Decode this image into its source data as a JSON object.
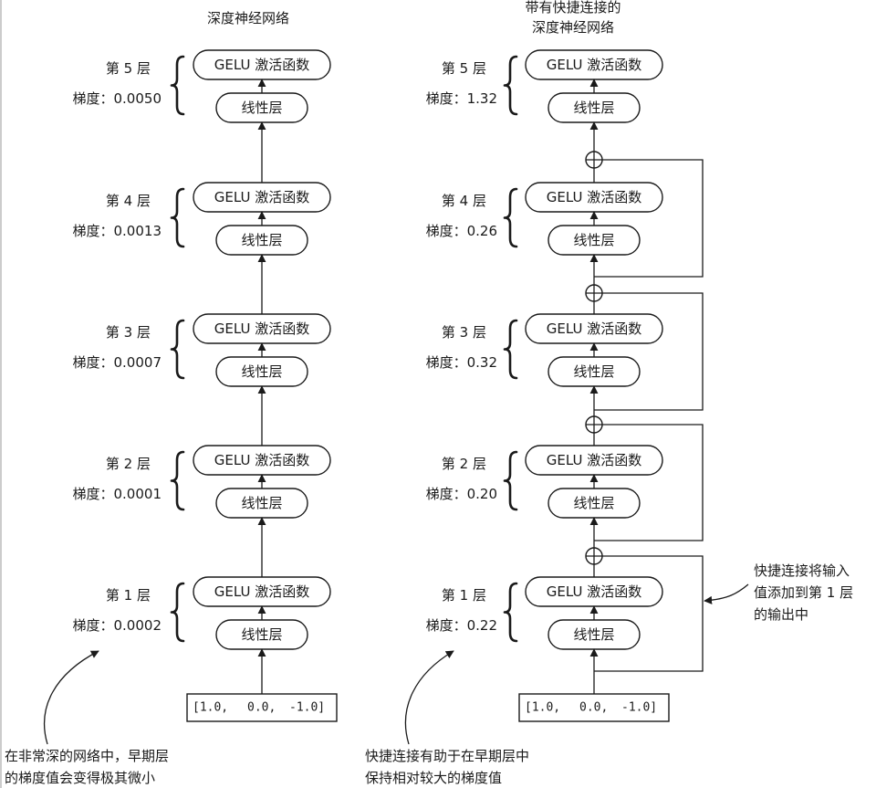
{
  "left": {
    "title": "深度神经网络",
    "input": [
      "[1.0,",
      "0.0,",
      "-1.0]"
    ],
    "layers": [
      {
        "name": "第 5 层",
        "grad": "梯度：0.0050",
        "act": "GELU 激活函数",
        "lin": "线性层"
      },
      {
        "name": "第 4 层",
        "grad": "梯度：0.0013",
        "act": "GELU 激活函数",
        "lin": "线性层"
      },
      {
        "name": "第 3 层",
        "grad": "梯度：0.0007",
        "act": "GELU 激活函数",
        "lin": "线性层"
      },
      {
        "name": "第 2 层",
        "grad": "梯度：0.0001",
        "act": "GELU 激活函数",
        "lin": "线性层"
      },
      {
        "name": "第 1 层",
        "grad": "梯度：0.0002",
        "act": "GELU 激活函数",
        "lin": "线性层"
      }
    ],
    "note": [
      "在非常深的网络中，早期层",
      "的梯度值会变得极其微小"
    ]
  },
  "right": {
    "title": [
      "带有快捷连接的",
      "深度神经网络"
    ],
    "input": [
      "[1.0,",
      "0.0,",
      "-1.0]"
    ],
    "layers": [
      {
        "name": "第 5 层",
        "grad": "梯度：1.32",
        "act": "GELU 激活函数",
        "lin": "线性层"
      },
      {
        "name": "第 4 层",
        "grad": "梯度：0.26",
        "act": "GELU 激活函数",
        "lin": "线性层"
      },
      {
        "name": "第 3 层",
        "grad": "梯度：0.32",
        "act": "GELU 激活函数",
        "lin": "线性层"
      },
      {
        "name": "第 2 层",
        "grad": "梯度：0.20",
        "act": "GELU 激活函数",
        "lin": "线性层"
      },
      {
        "name": "第 1 层",
        "grad": "梯度：0.22",
        "act": "GELU 激活函数",
        "lin": "线性层"
      }
    ],
    "note": [
      "快捷连接有助于在早期层中",
      "保持相对较大的梯度值"
    ],
    "side_note": [
      "快捷连接将输入",
      "值添加到第 1 层",
      "的输出中"
    ]
  }
}
